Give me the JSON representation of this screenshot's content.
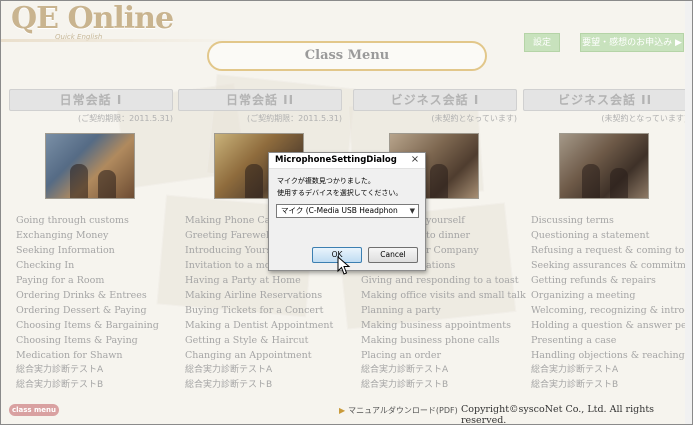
{
  "header": {
    "logo_main": "QE Online",
    "logo_sub": "Quick English",
    "menu_title": "Class Menu",
    "btn_settings": "設定",
    "btn_contact": "要望・感想のお申込み ▶"
  },
  "columns": [
    {
      "title": "日常会話 I",
      "note": "(ご契約期限：2011.5.31)",
      "items": [
        "Going through customs",
        "Exchanging Money",
        "Seeking Information",
        "Checking In",
        "Paying for a Room",
        "Ordering Drinks & Entrees",
        "Ordering Dessert & Paying",
        "Choosing Items & Bargaining",
        "Choosing Items & Paying",
        "Medication for Shawn",
        "総合実力診断テストA",
        "総合実力診断テストB"
      ]
    },
    {
      "title": "日常会話 II",
      "note": "(ご契約期限：2011.5.31)",
      "items": [
        "Making Phone Calls",
        "Greeting Farewells &",
        "Introducing Yourself",
        "Invitation to a movie",
        "Having a Party at Home",
        "Making Airline Reservations",
        "Buying Tickets for a Concert",
        "Making a Dentist Appointment",
        "Getting a Style & Haircut",
        "Changing an Appointment",
        "総合実力診断テストA",
        "総合実力診断テストB"
      ]
    },
    {
      "title": "ビジネス会話 I",
      "note": "(未契約となっています)",
      "items": [
        "yourself",
        "to dinner",
        "r Company",
        "ations",
        "Giving and responding to a toast",
        "Making office visits and small talk",
        "Planning a party",
        "Making business appointments",
        "Making business phone calls",
        "Placing an order",
        "総合実力診断テストA",
        "総合実力診断テストB"
      ]
    },
    {
      "title": "ビジネス会話 II",
      "note": "(未契約となっています)",
      "items": [
        "Discussing terms",
        "Questioning a statement",
        "Refusing a request & coming to an agre",
        "Seeking assurances & commitments",
        "Getting refunds & repairs",
        "Organizing a meeting",
        "Welcoming, recognizing & introducing",
        "Holding a question & answer period",
        "Presenting a case",
        "Handling objections & reaching a cons",
        "総合実力診断テストA",
        "総合実力診断テストB"
      ]
    }
  ],
  "footer": {
    "class_menu_btn": "class menu",
    "manual": "マニュアルダウンロード(PDF)",
    "copyright": "Copyright©syscoNet Co., Ltd. All rights reserved."
  },
  "dialog": {
    "title": "MicrophoneSettingDialog",
    "close": "×",
    "line1": "マイクが複数見つかりました。",
    "line2": "使用するデバイスを選択してください。",
    "selected_device": "マイク (C-Media USB Headphon",
    "ok": "OK",
    "cancel": "Cancel"
  }
}
